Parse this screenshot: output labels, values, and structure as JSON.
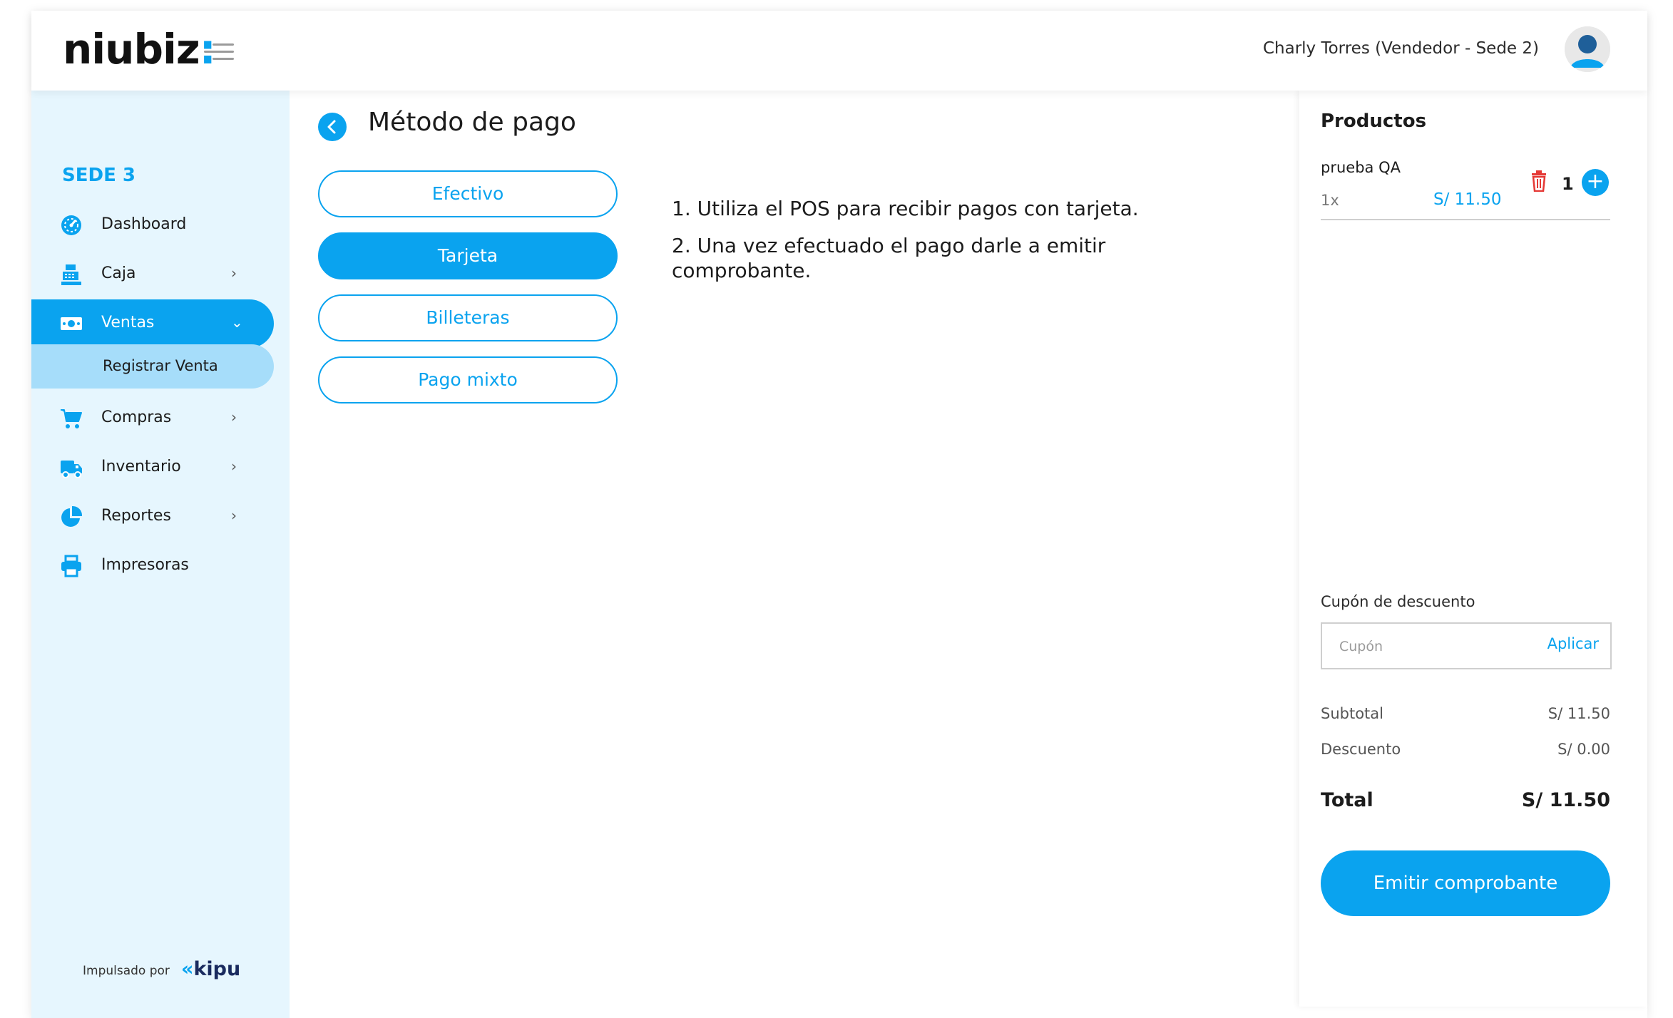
{
  "header": {
    "logo_text": "niubiz",
    "logo_colon": ":",
    "user": "Charly Torres (Vendedor - Sede 2)"
  },
  "sidebar": {
    "sede": "SEDE 3",
    "items": [
      {
        "label": "Dashboard",
        "icon": "dashboard-icon"
      },
      {
        "label": "Caja",
        "icon": "cash-register-icon",
        "chevron": "›"
      },
      {
        "label": "Ventas",
        "icon": "money-icon",
        "chevron": "⌄",
        "active": true
      },
      {
        "label": "Compras",
        "icon": "cart-icon",
        "chevron": "›"
      },
      {
        "label": "Inventario",
        "icon": "truck-icon",
        "chevron": "›"
      },
      {
        "label": "Reportes",
        "icon": "pie-chart-icon",
        "chevron": "›"
      },
      {
        "label": "Impresoras",
        "icon": "printer-icon"
      }
    ],
    "sub_item": "Registrar Venta",
    "powered_by": "Impulsado por",
    "brand": "kipu"
  },
  "main": {
    "title": "Método de pago",
    "methods": [
      "Efectivo",
      "Tarjeta",
      "Billeteras",
      "Pago mixto"
    ],
    "selected_method": "Tarjeta",
    "instructions": [
      "1. Utiliza el POS para recibir pagos con tarjeta.",
      "2. Una vez efectuado el pago darle a emitir",
      "comprobante."
    ]
  },
  "cart": {
    "title": "Productos",
    "product": {
      "name": "prueba QA",
      "qty_label": "1x",
      "price": "S/ 11.50",
      "quantity": "1"
    },
    "coupon": {
      "label": "Cupón de descuento",
      "placeholder": "Cupón",
      "apply": "Aplicar"
    },
    "subtotal_label": "Subtotal",
    "subtotal_value": "S/ 11.50",
    "discount_label": "Descuento",
    "discount_value": "S/ 0.00",
    "total_label": "Total",
    "total_value": "S/ 11.50",
    "emit_button": "Emitir comprobante"
  },
  "colors": {
    "accent": "#0aa3ef",
    "sidebar_bg": "#e6f6fe",
    "sub_item_bg": "#a6ddfa",
    "danger": "#e53935"
  }
}
